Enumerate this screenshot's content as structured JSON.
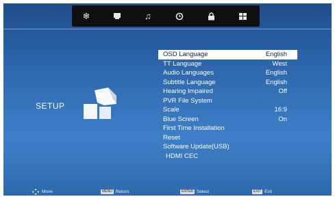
{
  "topbar": {
    "tabs": [
      {
        "name": "picture",
        "icon": "snowflake-icon",
        "glyph": "❄"
      },
      {
        "name": "monitor",
        "icon": "monitor-icon"
      },
      {
        "name": "sound",
        "icon": "music-note-icon",
        "glyph": "♫"
      },
      {
        "name": "time",
        "icon": "clock-icon"
      },
      {
        "name": "lock",
        "icon": "lock-icon"
      },
      {
        "name": "setup",
        "icon": "grid-icon"
      }
    ]
  },
  "section_title": "SETUP",
  "menu": {
    "items": [
      {
        "label": "OSD Language",
        "value": "English",
        "selected": true
      },
      {
        "label": "TT  Language",
        "value": "West"
      },
      {
        "label": "Audio Languages",
        "value": "English"
      },
      {
        "label": "Subtitle Language",
        "value": "English"
      },
      {
        "label": "Hearing Impaired",
        "value": "Off"
      },
      {
        "label": "PVR File System",
        "value": ""
      },
      {
        "label": "Scale",
        "value": "16:9"
      },
      {
        "label": "Blue Screen",
        "value": "On"
      },
      {
        "label": "First Time Installation",
        "value": ""
      },
      {
        "label": "Reset",
        "value": ""
      },
      {
        "label": "Software Update(USB)",
        "value": ""
      },
      {
        "label": "HDMI  CEC",
        "value": "",
        "indent": true
      }
    ]
  },
  "hints": {
    "move": "Move",
    "return_key": "MENU",
    "return": "Return",
    "select_key": "ENTER",
    "select": "Select",
    "exit_key": "EXIT",
    "exit": "Exit"
  },
  "colors": {
    "background_top": "#1f4d8c",
    "background_bottom": "#3d80c8",
    "topbar": "#0f0f12",
    "selected_row": "#ffffff"
  }
}
